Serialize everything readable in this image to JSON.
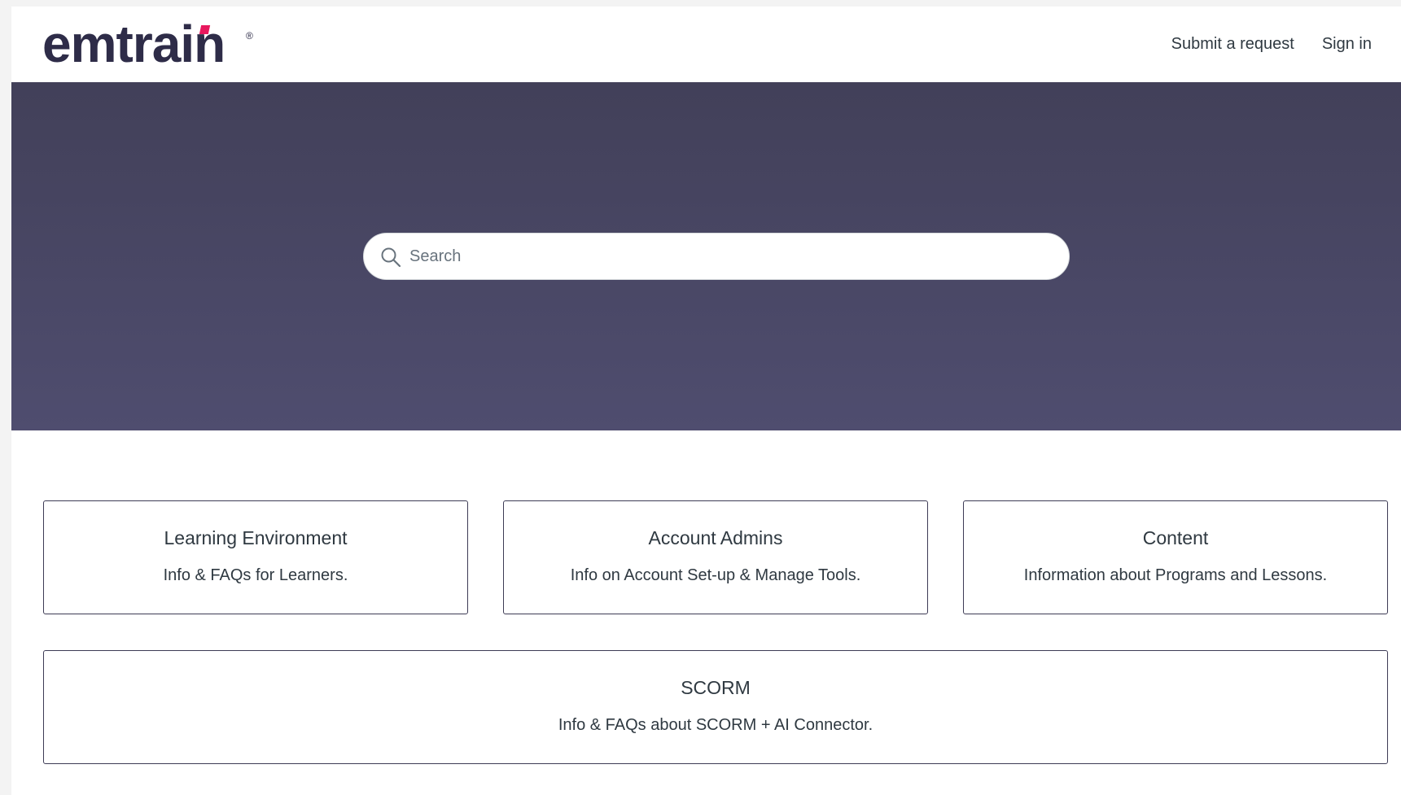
{
  "header": {
    "logo_text": "emtrain",
    "logo_mark": "®",
    "nav": {
      "submit_request": "Submit a request",
      "sign_in": "Sign in"
    }
  },
  "hero": {
    "search": {
      "placeholder": "Search",
      "value": "",
      "icon": "search-icon"
    }
  },
  "categories": [
    {
      "title": "Learning Environment",
      "description": "Info & FAQs for Learners."
    },
    {
      "title": "Account Admins",
      "description": "Info on Account Set-up & Manage Tools."
    },
    {
      "title": "Content",
      "description": "Information about Programs and Lessons."
    },
    {
      "title": "SCORM",
      "description": "Info & FAQs about SCORM + AI Connector."
    }
  ],
  "colors": {
    "brand_dark": "#2e2c48",
    "brand_accent": "#e8175d",
    "hero_top": "#424059",
    "hero_bottom": "#4f4d6f",
    "card_border": "#3d3b55",
    "text": "#2f3941"
  }
}
